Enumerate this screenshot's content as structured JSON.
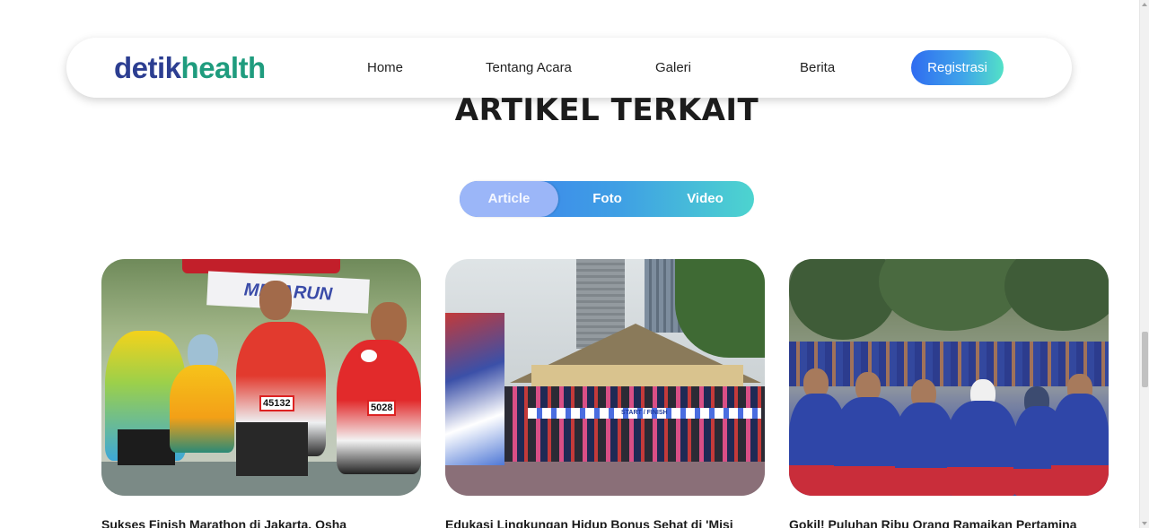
{
  "navbar": {
    "logo_part1": "detik",
    "logo_part2": "health",
    "links": [
      "Home",
      "Tentang Acara",
      "Galeri",
      "Berita"
    ],
    "register_label": "Registrasi"
  },
  "section": {
    "title": "ARTIKEL TERKAIT"
  },
  "tabs": {
    "items": [
      "Article",
      "Foto",
      "Video"
    ],
    "active": "Article"
  },
  "cards": [
    {
      "title": "Sukses Finish Marathon di Jakarta, Osha",
      "image_bib_1": "45132",
      "image_bib_2": "5028",
      "image_banner": "METARUN"
    },
    {
      "title": "Edukasi Lingkungan Hidup Bonus Sehat di 'Misi",
      "image_ribbon": "START / FINISH"
    },
    {
      "title": "Gokil! Puluhan Ribu Orang Ramaikan Pertamina"
    }
  ],
  "colors": {
    "brand_blue": "#2c3e91",
    "brand_green": "#1f9c7e",
    "gradient_start": "#2f6cf0",
    "gradient_end": "#53e1c7"
  }
}
